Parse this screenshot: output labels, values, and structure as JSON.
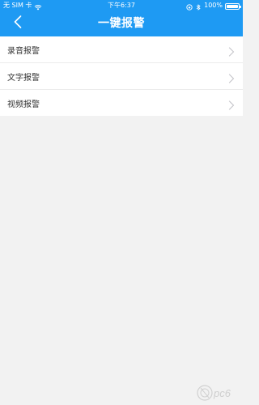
{
  "status_bar": {
    "carrier": "无 SIM 卡",
    "time": "下午6:37",
    "battery_text": "100%",
    "battery_level": 1.0
  },
  "header": {
    "title": "一键报警",
    "back_icon": "chevron-left-icon"
  },
  "menu": {
    "items": [
      {
        "label": "录音报警",
        "icon": "chevron-right-icon"
      },
      {
        "label": "文字报警",
        "icon": "chevron-right-icon"
      },
      {
        "label": "视频报警",
        "icon": "chevron-right-icon"
      }
    ]
  },
  "watermark": {
    "text": "pc6"
  },
  "colors": {
    "header_bg": "#1e9af3",
    "page_bg": "#f2f2f2",
    "list_bg": "#ffffff",
    "item_text": "#333333",
    "chevron": "#c7c7cc"
  }
}
